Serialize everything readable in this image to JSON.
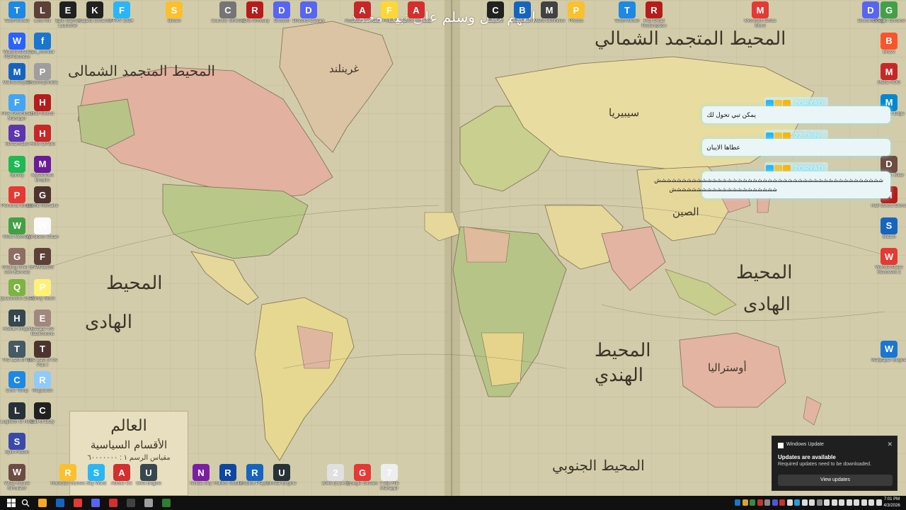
{
  "wallpaper": {
    "overlay_text": "اللهم صل وسلم على نبينا محمد",
    "ocean_labels": {
      "north_atlantic": "المحيط المتجمد الشمالي",
      "arctic_left": "المحيط المتجمد الشمالى",
      "pacific_west_1": "المحيط",
      "pacific_west_2": "الهادى",
      "indian_1": "المحيط",
      "indian_2": "الهندي",
      "pacific_east_1": "المحيط",
      "pacific_east_2": "الهادى",
      "southern": "المحيط الجنوبي"
    },
    "country_labels": {
      "russia": "سيبيريا",
      "greenland": "غرينلند",
      "china": "الصين",
      "australia": "أوستراليا"
    },
    "legend": {
      "title": "العالم",
      "subtitle": "الأقسام السياسية",
      "note": "مقياس الرسم ١ : ٦٠٠٠٠٠٠٠"
    }
  },
  "desktop_icons": {
    "col1": [
      {
        "label": "TeamViewer",
        "icon": "teamviewer-icon",
        "color": "#1e88e5"
      },
      {
        "label": "Wondershare PDFelement",
        "icon": "pdfelement-icon",
        "color": "#2962ff"
      },
      {
        "label": "Malwarebytes",
        "icon": "malwarebytes-icon",
        "color": "#1565c0"
      },
      {
        "label": "Free Download Manager",
        "icon": "fdm-icon",
        "color": "#42a5f5"
      },
      {
        "label": "Streamlabs",
        "icon": "streamlabs-icon",
        "color": "#5e35b1"
      },
      {
        "label": "Spotify",
        "icon": "spotify-icon",
        "color": "#1db954"
      },
      {
        "label": "Personal Brave",
        "icon": "brave-icon",
        "color": "#e53935"
      },
      {
        "label": "Wise Memory",
        "icon": "wise-memory-icon",
        "color": "#43a047"
      },
      {
        "label": "Getting Over It with Bennett",
        "icon": "game-icon",
        "color": "#8d6e63"
      },
      {
        "label": "Quarantine Zone",
        "icon": "quarantine-icon",
        "color": "#7cb342"
      },
      {
        "label": "Hollow Knight",
        "icon": "knight-icon",
        "color": "#37474f"
      },
      {
        "label": "The Last of Us",
        "icon": "tlou-icon",
        "color": "#455a64"
      },
      {
        "label": "Core Temp",
        "icon": "coretemp-icon",
        "color": "#1e88e5"
      },
      {
        "label": "Logitech G HUB",
        "icon": "ghub-icon",
        "color": "#263238"
      },
      {
        "label": "Split Fiction",
        "icon": "splitfiction-icon",
        "color": "#3949ab"
      },
      {
        "label": "Wrap House Simulator",
        "icon": "house-icon",
        "color": "#6d4c41"
      }
    ],
    "col2": [
      {
        "label": "Lost Ark",
        "icon": "lostark-icon",
        "color": "#5d4037"
      },
      {
        "label": "fps_monitor",
        "icon": "fps-icon",
        "color": "#1976d2"
      },
      {
        "label": "Phasmophobia",
        "icon": "ghost-icon",
        "color": "#9e9e9e"
      },
      {
        "label": "Half-Sword",
        "icon": "sword-icon",
        "color": "#b71c1c"
      },
      {
        "label": "HMS DIAblo",
        "icon": "diablo-icon",
        "color": "#c62828"
      },
      {
        "label": "Mysterious Empire",
        "icon": "empire-icon",
        "color": "#6a1b9a"
      },
      {
        "label": "Gothic Remake",
        "icon": "gothic-icon",
        "color": "#4e342e"
      },
      {
        "label": "Windows Clean",
        "icon": "clean-icon",
        "color": "#fafafa"
      },
      {
        "label": "FAMACOS",
        "icon": "famacos-icon",
        "color": "#5d4037"
      },
      {
        "label": "Penny Store",
        "icon": "store-icon",
        "color": "#fff176"
      },
      {
        "label": "Escape the Backrooms",
        "icon": "backrooms-icon",
        "color": "#a1887f"
      },
      {
        "label": "The Last of Us Part I",
        "icon": "tlou-icon",
        "color": "#4e342e"
      },
      {
        "label": "Reguardo",
        "icon": "reguardo-icon",
        "color": "#90caf9"
      },
      {
        "label": "Call of Duty",
        "icon": "cod-icon",
        "color": "#212121"
      }
    ],
    "top_row": [
      {
        "label": "Epic Games Launcher",
        "icon": "epic-icon",
        "color": "#202020"
      },
      {
        "label": "Kajaria Ceramic",
        "icon": "kajaria-icon",
        "color": "#212121"
      },
      {
        "label": "FFXV 2024",
        "icon": "ffxv-icon",
        "color": "#29b6f6"
      },
      {
        "label": "Steam",
        "icon": "steam-icon",
        "color": "#fbc02d"
      },
      {
        "label": "Counter Strike 2",
        "icon": "cs2-icon",
        "color": "#757575"
      },
      {
        "label": "ROG Armoury",
        "icon": "rog-icon",
        "color": "#b71c1c"
      },
      {
        "label": "Discord",
        "icon": "discord-icon",
        "color": "#5865f2"
      },
      {
        "label": "Discord Canary",
        "icon": "discord-icon",
        "color": "#5865f2"
      },
      {
        "label": "Assassin's Creed",
        "icon": "ac-icon",
        "color": "#c62828"
      },
      {
        "label": "Folder",
        "icon": "folder-icon",
        "color": "#fdd835"
      },
      {
        "label": "Adobe Acrobat",
        "icon": "acrobat-icon",
        "color": "#d32f2f"
      },
      {
        "label": "CapCut",
        "icon": "capcut-icon",
        "color": "#212121"
      },
      {
        "label": "Battle.net",
        "icon": "bnet-icon",
        "color": "#1565c0"
      },
      {
        "label": "Mafia Definitive",
        "icon": "mafia-icon",
        "color": "#424242"
      },
      {
        "label": "Photos",
        "icon": "photos-icon",
        "color": "#fbc02d"
      },
      {
        "label": "TeamViewer",
        "icon": "teamviewer-icon",
        "color": "#1e88e5"
      },
      {
        "label": "Red Dead Redemption",
        "icon": "rdr-icon",
        "color": "#b71c1c"
      },
      {
        "label": "Microsoft Office Store",
        "icon": "office-icon",
        "color": "#e53935"
      },
      {
        "label": "Discord PTB",
        "icon": "discord-icon",
        "color": "#5865f2"
      }
    ],
    "bottom_row": [
      {
        "label": "Rockstar Games",
        "icon": "rockstar-icon",
        "color": "#fbc02d"
      },
      {
        "label": "Sky Ward",
        "icon": "skyward-icon",
        "color": "#29b6f6"
      },
      {
        "label": "Adobe CC",
        "icon": "adobe-icon",
        "color": "#d32f2f"
      },
      {
        "label": "Ultra Engine",
        "icon": "engine-icon",
        "color": "#37474f"
      },
      {
        "label": "Nvidia Sky",
        "icon": "nvidia-icon",
        "color": "#7b1fa2"
      },
      {
        "label": "Roblox Studio",
        "icon": "roblox-studio-icon",
        "color": "#0d47a1"
      },
      {
        "label": "Roblox Player",
        "icon": "roblox-icon",
        "color": "#1565c0"
      },
      {
        "label": "Unreal Engine",
        "icon": "unreal-icon",
        "color": "#263238"
      },
      {
        "label": "2048 (3.24.6)",
        "icon": "2048-icon",
        "color": "#e0e0e0"
      },
      {
        "label": "Google Stream",
        "icon": "pin-icon",
        "color": "#e53935"
      },
      {
        "label": "7-Zip File Manager",
        "icon": "7zip-icon",
        "color": "#eeeeee"
      }
    ],
    "right_col": [
      {
        "label": "Google Chrome",
        "icon": "chrome-icon",
        "color": "#43a047"
      },
      {
        "label": "Brave",
        "icon": "brave-icon",
        "color": "#fb542b"
      },
      {
        "label": "Mafia ROG",
        "icon": "rog-icon",
        "color": "#c62828"
      },
      {
        "label": "Microsoft Edge",
        "icon": "edge-icon",
        "color": "#0288d1"
      },
      {
        "label": "Dungeon Killer",
        "icon": "dungeon-icon",
        "color": "#6d4c41"
      },
      {
        "label": "Half Sword Demo",
        "icon": "sword-icon",
        "color": "#b71c1c"
      },
      {
        "label": "Steam",
        "icon": "steam-icon",
        "color": "#1565c0"
      },
      {
        "label": "Wondershare Recoverit 2",
        "icon": "recoverit-icon",
        "color": "#e53935"
      },
      {
        "label": "Wallpaper Engine",
        "icon": "wallpaper-engine-icon",
        "color": "#1976d2"
      }
    ]
  },
  "chat_overlay": {
    "messages": [
      {
        "username": "ZORYAD",
        "text": "يمكن تبي تحول لك"
      },
      {
        "username": "27_July",
        "text": "عطاها الايبان"
      },
      {
        "username": "ZORYAD",
        "line1": "ششششششششششششششششششششششششششششششششششششششششششششش",
        "line2": "ششششششششششششششششششششش"
      }
    ]
  },
  "toast": {
    "app_name": "Windows Update",
    "title": "Updates are available",
    "body": "Required updates need to be downloaded.",
    "button": "View updates"
  },
  "taskbar": {
    "pinned": [
      {
        "icon": "file-explorer-icon",
        "color": "#f9a825"
      },
      {
        "icon": "steam-icon",
        "color": "#1565c0"
      },
      {
        "icon": "opera-icon",
        "color": "#e53935"
      },
      {
        "icon": "discord-icon",
        "color": "#5865f2"
      },
      {
        "icon": "adobe-icon",
        "color": "#d32f2f"
      },
      {
        "icon": "obs-icon",
        "color": "#424242"
      },
      {
        "icon": "settings-icon",
        "color": "#9e9e9e"
      },
      {
        "icon": "terminal-icon",
        "color": "#2e7d32"
      }
    ],
    "time": "7:01 PM",
    "date": "4/3/2026"
  },
  "colors": {
    "ocean": "#d2ccaa",
    "taskbar": "#101010",
    "toast_bg": "#1f1f1f",
    "chat_glow": "#5fd9ee"
  }
}
